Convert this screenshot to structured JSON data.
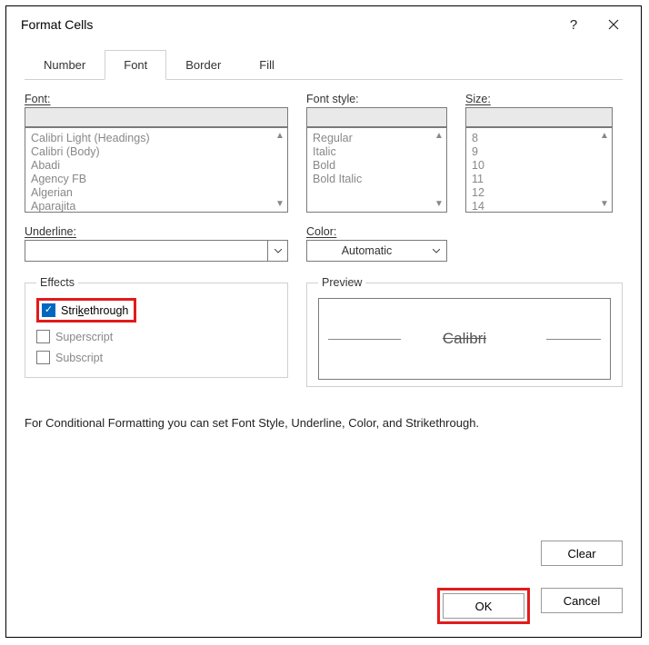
{
  "title": "Format Cells",
  "tabs": [
    "Number",
    "Font",
    "Border",
    "Fill"
  ],
  "activeTab": "Font",
  "labels": {
    "font": "Font:",
    "fontStyle": "Font style:",
    "size": "Size:",
    "underline": "Underline:",
    "color": "Color:",
    "effects": "Effects",
    "preview": "Preview"
  },
  "fontList": [
    "Calibri Light (Headings)",
    "Calibri (Body)",
    "Abadi",
    "Agency FB",
    "Algerian",
    "Aparajita"
  ],
  "styleList": [
    "Regular",
    "Italic",
    "Bold",
    "Bold Italic"
  ],
  "sizeList": [
    "8",
    "9",
    "10",
    "11",
    "12",
    "14"
  ],
  "underlineValue": "",
  "colorValue": "Automatic",
  "effects": {
    "strikethrough": {
      "label": "Strikethrough",
      "checked": true
    },
    "superscript": {
      "label": "Superscript",
      "checked": false
    },
    "subscript": {
      "label": "Subscript",
      "checked": false
    }
  },
  "previewText": "Calibri",
  "note": "For Conditional Formatting you can set Font Style, Underline, Color, and Strikethrough.",
  "buttons": {
    "clear": "Clear",
    "ok": "OK",
    "cancel": "Cancel"
  },
  "highlight": {
    "strikethrough": true,
    "ok": true
  }
}
